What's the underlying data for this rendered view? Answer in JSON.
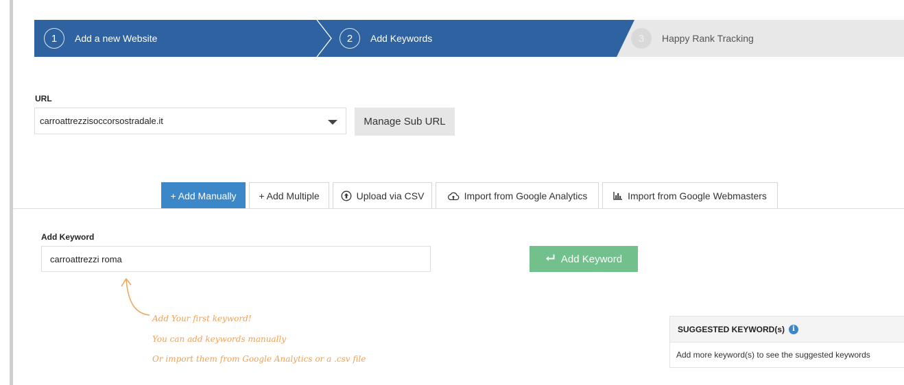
{
  "wizard": {
    "steps": [
      {
        "number": "1",
        "label": "Add a new Website"
      },
      {
        "number": "2",
        "label": "Add Keywords"
      },
      {
        "number": "3",
        "label": "Happy Rank Tracking"
      }
    ],
    "active_color": "#2f62a0",
    "inactive_color": "#e8e8e8"
  },
  "url": {
    "label": "URL",
    "selected": "carroattrezzisoccorsostradale.it",
    "manage_label": "Manage Sub URL"
  },
  "tabs": [
    {
      "label": "+ Add Manually",
      "active": true
    },
    {
      "label": "+ Add Multiple"
    },
    {
      "label": "Upload via CSV",
      "icon": "upload-circle-icon"
    },
    {
      "label": "Import from Google Analytics",
      "icon": "cloud-upload-icon"
    },
    {
      "label": "Import from Google Webmasters",
      "icon": "bar-chart-icon"
    }
  ],
  "keyword": {
    "label": "Add Keyword",
    "value": "carroattrezzi roma",
    "button_label": "Add Keyword",
    "button_color": "#72c08b"
  },
  "hint": {
    "lines": [
      "Add Your first keyword!",
      "You can add keywords manually",
      "Or import them from Google Analytics or a .csv file"
    ],
    "color": "#f0a255"
  },
  "suggested": {
    "title": "SUGGESTED KEYWORD(s)",
    "body": "Add more keyword(s) to see the suggested keywords"
  }
}
